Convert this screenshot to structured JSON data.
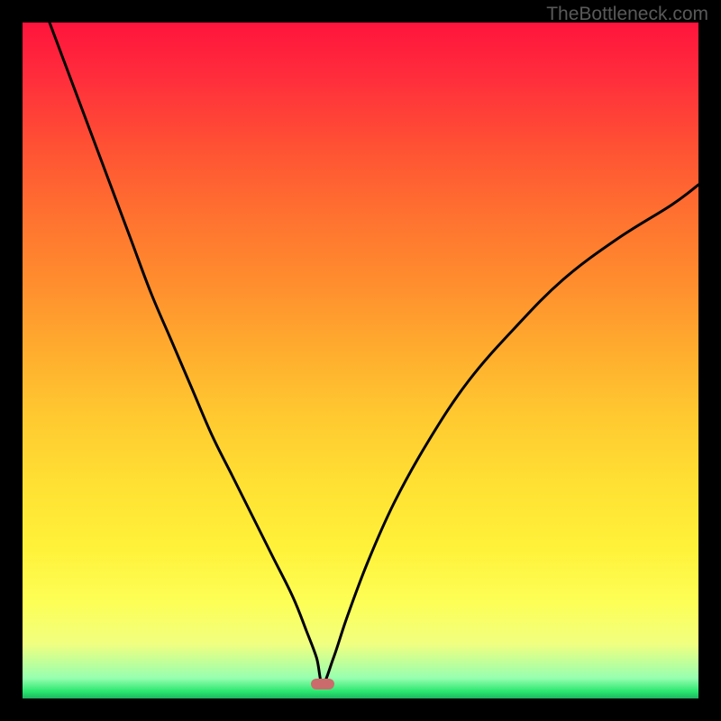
{
  "watermark": "TheBottleneck.com",
  "dip": {
    "x_frac": 0.444,
    "y_frac": 0.978
  },
  "chart_data": {
    "type": "line",
    "title": "",
    "xlabel": "",
    "ylabel": "",
    "xlim": [
      0,
      100
    ],
    "ylim": [
      0,
      100
    ],
    "series": [
      {
        "name": "curve",
        "x": [
          4,
          7,
          10,
          13,
          16,
          19,
          22,
          25,
          28,
          31,
          34,
          37,
          40,
          42,
          43.5,
          44.4,
          46,
          48,
          51,
          55,
          60,
          66,
          73,
          80,
          88,
          96,
          100
        ],
        "y": [
          100,
          92,
          84,
          76,
          68,
          60,
          53,
          46,
          39,
          33,
          27,
          21,
          15,
          10,
          6,
          2.2,
          6,
          12,
          20,
          29,
          38,
          47,
          55,
          62,
          68,
          73,
          76
        ]
      }
    ],
    "marker": {
      "x": 44.4,
      "y": 2.2,
      "color": "#cc6b6b"
    },
    "background_gradient": [
      "#ff143c",
      "#ffe033",
      "#1db560"
    ]
  }
}
